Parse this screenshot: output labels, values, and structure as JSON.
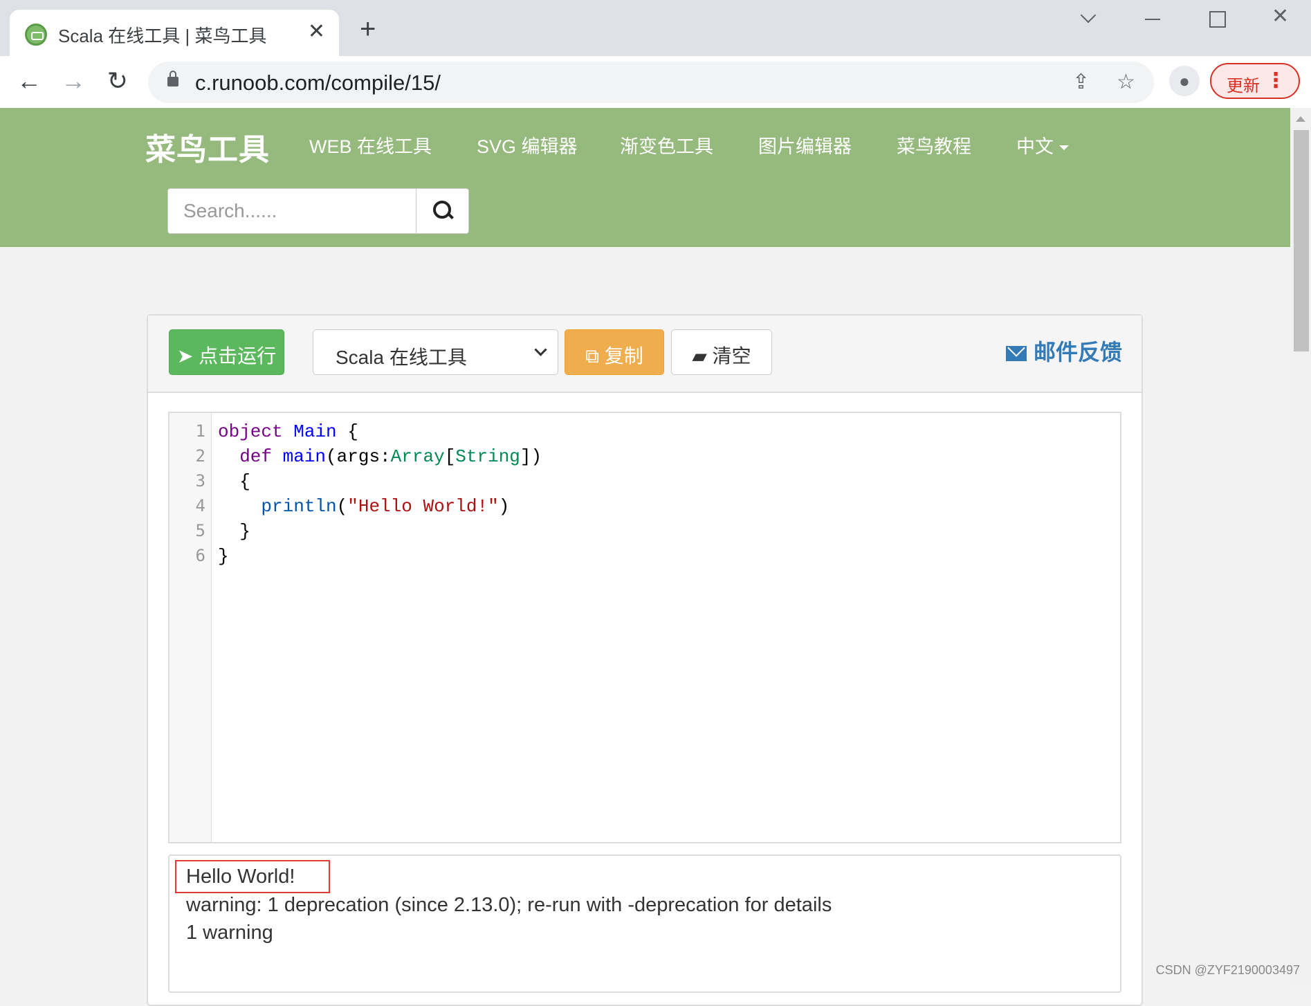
{
  "browser": {
    "tab_title": "Scala 在线工具 | 菜鸟工具",
    "tab_close": "✕",
    "new_tab": "+",
    "url": "c.runoob.com/compile/15/",
    "update_label": "更新",
    "menu_dots": "⋮"
  },
  "site": {
    "logo": "菜鸟工具",
    "nav": [
      "WEB 在线工具",
      "SVG 编辑器",
      "渐变色工具",
      "图片编辑器",
      "菜鸟教程",
      "中文"
    ],
    "search_placeholder": "Search......"
  },
  "toolbar": {
    "run_label": "点击运行",
    "language": "Scala 在线工具",
    "copy_label": "复制",
    "clear_label": "清空",
    "feedback_label": "邮件反馈"
  },
  "editor": {
    "line_numbers": [
      "1",
      "2",
      "3",
      "4",
      "5",
      "6"
    ],
    "lines": [
      [
        {
          "t": "object",
          "c": "kw"
        },
        {
          "t": " ",
          "c": "plain"
        },
        {
          "t": "Main",
          "c": "def"
        },
        {
          "t": " {",
          "c": "plain"
        }
      ],
      [
        {
          "t": "  def",
          "c": "kw"
        },
        {
          "t": " ",
          "c": "plain"
        },
        {
          "t": "main",
          "c": "def"
        },
        {
          "t": "(args:",
          "c": "plain"
        },
        {
          "t": "Array",
          "c": "typ"
        },
        {
          "t": "[",
          "c": "plain"
        },
        {
          "t": "String",
          "c": "typ"
        },
        {
          "t": "])",
          "c": "plain"
        }
      ],
      [
        {
          "t": "  {",
          "c": "plain"
        }
      ],
      [
        {
          "t": "    println",
          "c": "var"
        },
        {
          "t": "(",
          "c": "plain"
        },
        {
          "t": "\"Hello World!\"",
          "c": "str"
        },
        {
          "t": ")",
          "c": "plain"
        }
      ],
      [
        {
          "t": "  }",
          "c": "plain"
        }
      ],
      [
        {
          "t": "}",
          "c": "plain"
        }
      ]
    ]
  },
  "output": {
    "lines": [
      "Hello World!",
      "warning: 1 deprecation (since 2.13.0); re-run with -deprecation for details",
      "1 warning"
    ]
  },
  "watermark": "CSDN @ZYF2190003497",
  "colors": {
    "header_green": "#96b97d",
    "run_green": "#5cb85c",
    "copy_orange": "#f0ad4e",
    "feedback_blue": "#337ab7",
    "highlight_red": "#e53935"
  },
  "icons": [
    "favicon-icon",
    "back-arrow-icon",
    "forward-arrow-icon",
    "reload-icon",
    "lock-icon",
    "share-icon",
    "star-icon",
    "profile-icon",
    "search-icon",
    "paper-plane-icon",
    "copy-icon",
    "eraser-icon",
    "envelope-icon"
  ]
}
